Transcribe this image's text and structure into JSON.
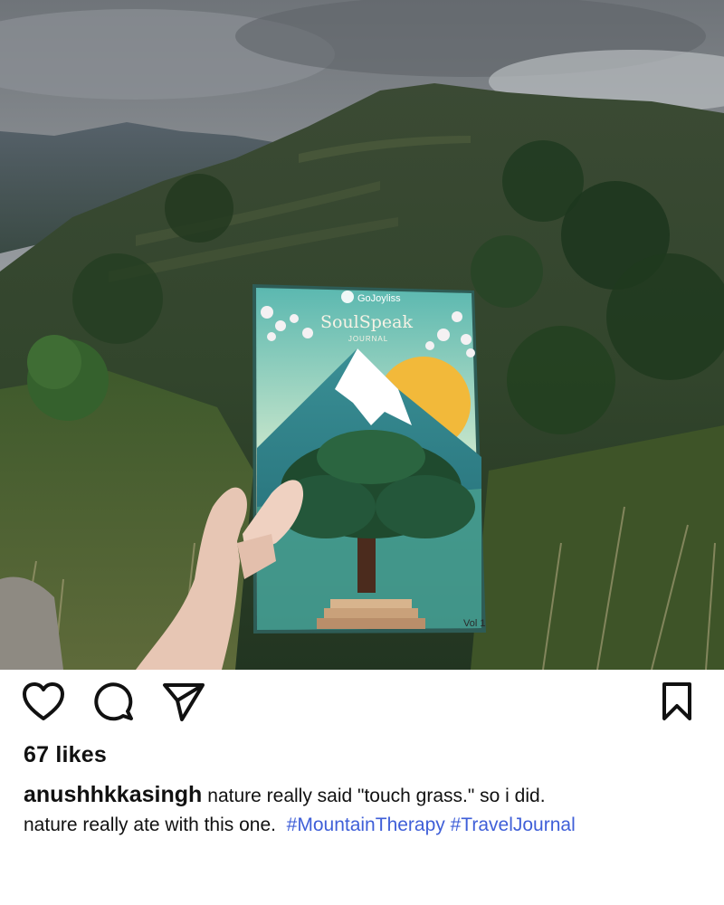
{
  "photo": {
    "alt_scene": "mountain-valley-with-journal",
    "book": {
      "brand": "GoJoyliss",
      "title": "SoulSpeak",
      "subtitle": "JOURNAL",
      "volume": "Vol 1"
    }
  },
  "actions": {
    "like_icon": "heart-icon",
    "comment_icon": "comment-icon",
    "share_icon": "send-icon",
    "save_icon": "bookmark-icon"
  },
  "likes": {
    "label": "67 likes"
  },
  "caption": {
    "username": "anushhkkasingh",
    "text_line1": "nature really said \"touch grass.\" so i did.",
    "text_line2": "nature really ate with this one.",
    "hashtags": [
      "#MountainTherapy",
      "#TravelJournal"
    ]
  },
  "colors": {
    "hashtag": "#3f5fd8",
    "text": "#111111",
    "background": "#ffffff"
  }
}
